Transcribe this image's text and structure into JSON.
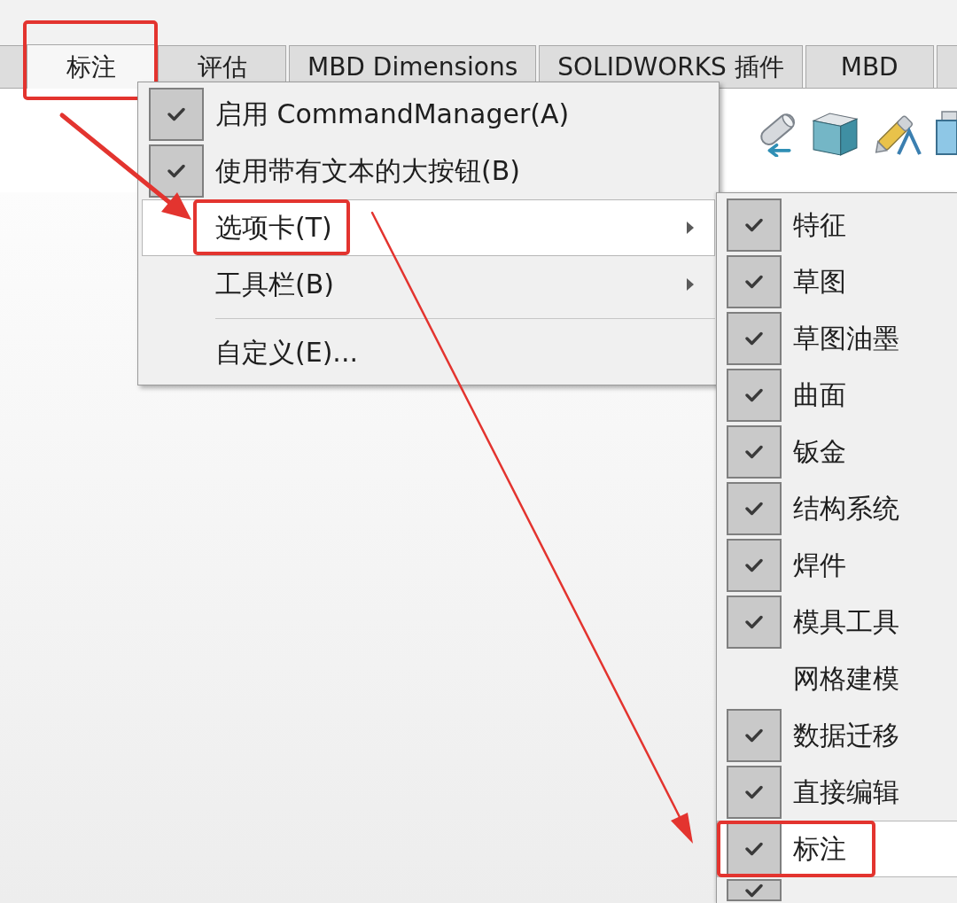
{
  "tabs": [
    {
      "selected": false,
      "framed": false
    },
    {
      "label": "标注",
      "selected": true,
      "framed": true
    },
    {
      "label": "评估",
      "selected": false,
      "framed": false
    },
    {
      "label": "MBD Dimensions",
      "selected": false,
      "framed": false
    },
    {
      "label": "SOLIDWORKS 插件",
      "selected": false,
      "framed": false
    },
    {
      "label": "MBD",
      "selected": false,
      "framed": false
    },
    {
      "selected": false,
      "framed": false
    }
  ],
  "context_menu": {
    "items": [
      {
        "kind": "item",
        "label": "启用 CommandManager(A)",
        "checked": true,
        "highlighted": false,
        "submenu": false,
        "framed": false
      },
      {
        "kind": "item",
        "label": "使用带有文本的大按钮(B)",
        "checked": true,
        "highlighted": false,
        "submenu": false,
        "framed": false
      },
      {
        "kind": "item",
        "label": "选项卡(T)",
        "checked": false,
        "highlighted": true,
        "submenu": true,
        "framed": true
      },
      {
        "kind": "item",
        "label": "工具栏(B)",
        "checked": false,
        "highlighted": false,
        "submenu": true,
        "framed": false
      },
      {
        "kind": "separator"
      },
      {
        "kind": "item",
        "label": "自定义(E)...",
        "checked": false,
        "highlighted": false,
        "submenu": false,
        "framed": false
      }
    ]
  },
  "submenu": {
    "items": [
      {
        "label": "特征",
        "checked": true,
        "highlighted": false,
        "framed": false
      },
      {
        "label": "草图",
        "checked": true,
        "highlighted": false,
        "framed": false
      },
      {
        "label": "草图油墨",
        "checked": true,
        "highlighted": false,
        "framed": false
      },
      {
        "label": "曲面",
        "checked": true,
        "highlighted": false,
        "framed": false
      },
      {
        "label": "钣金",
        "checked": true,
        "highlighted": false,
        "framed": false
      },
      {
        "label": "结构系统",
        "checked": true,
        "highlighted": false,
        "framed": false
      },
      {
        "label": "焊件",
        "checked": true,
        "highlighted": false,
        "framed": false
      },
      {
        "label": "模具工具",
        "checked": true,
        "highlighted": false,
        "framed": false
      },
      {
        "label": "网格建模",
        "checked": false,
        "highlighted": false,
        "framed": false
      },
      {
        "label": "数据迁移",
        "checked": true,
        "highlighted": false,
        "framed": false
      },
      {
        "label": "直接编辑",
        "checked": true,
        "highlighted": false,
        "framed": false
      },
      {
        "label": "标注",
        "checked": true,
        "highlighted": true,
        "framed": true
      },
      {
        "checked": true,
        "highlighted": false,
        "framed": false
      }
    ]
  }
}
